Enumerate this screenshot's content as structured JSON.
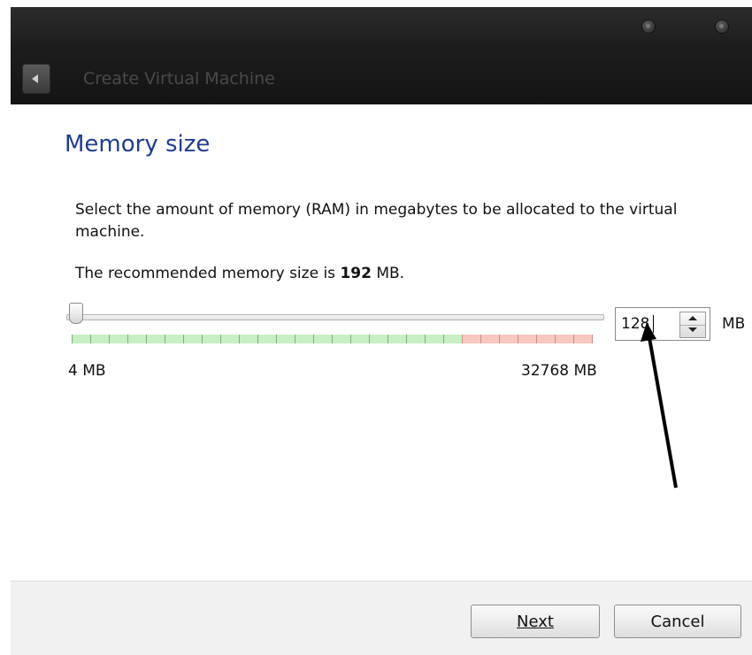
{
  "window": {
    "title": "Create Virtual Machine",
    "back_icon": "back-arrow-icon"
  },
  "page": {
    "heading": "Memory size",
    "description": "Select the amount of memory (RAM) in megabytes to be allocated to the virtual machine.",
    "recommend_prefix": "The recommended memory size is ",
    "recommend_value": "192",
    "recommend_suffix": " MB."
  },
  "memory": {
    "slider_min_label": "4 MB",
    "slider_max_label": "32768 MB",
    "value": "128",
    "unit": "MB"
  },
  "buttons": {
    "next": "Next",
    "cancel": "Cancel"
  }
}
